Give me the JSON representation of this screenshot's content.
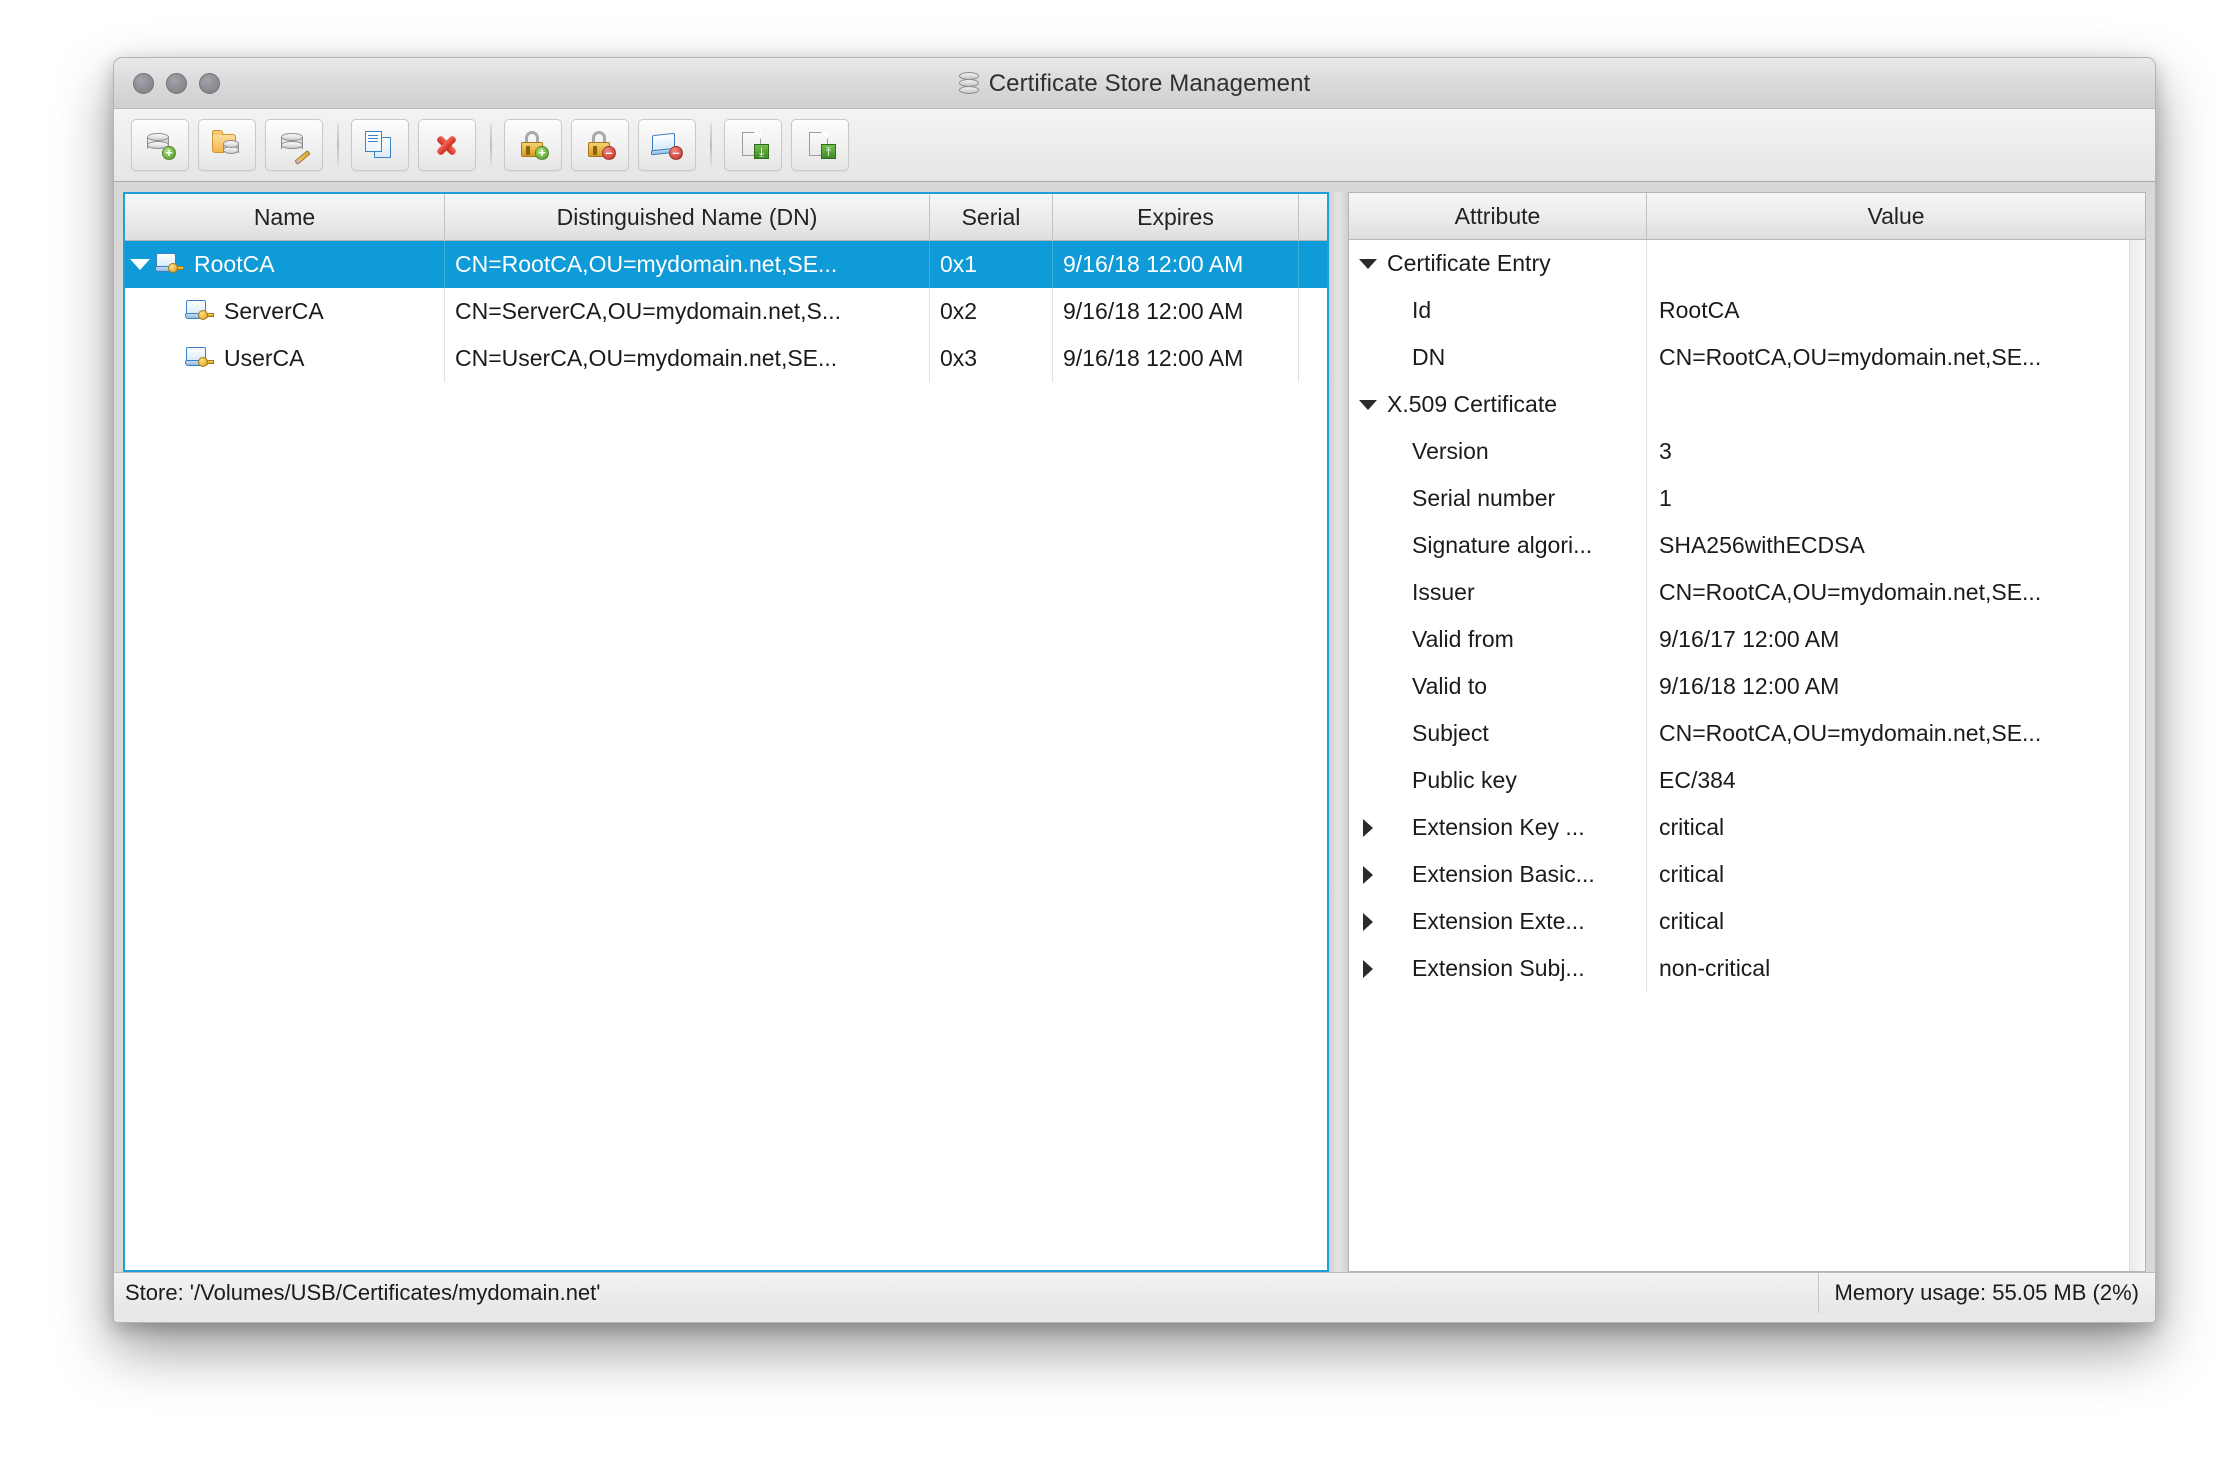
{
  "window": {
    "title": "Certificate Store Management",
    "title_icon": "database-icon",
    "traffic_lights": [
      "close",
      "minimize",
      "zoom"
    ]
  },
  "toolbar": {
    "groups": [
      {
        "buttons": [
          {
            "name": "new-store-button",
            "icon": "database-add-icon",
            "tooltip": "New store"
          },
          {
            "name": "open-store-button",
            "icon": "folder-database-icon",
            "tooltip": "Open store"
          },
          {
            "name": "edit-store-button",
            "icon": "database-edit-icon",
            "tooltip": "Edit store"
          }
        ]
      },
      {
        "buttons": [
          {
            "name": "copy-button",
            "icon": "copy-documents-icon",
            "tooltip": "Copy"
          },
          {
            "name": "delete-button",
            "icon": "red-x-icon",
            "tooltip": "Delete"
          }
        ]
      },
      {
        "buttons": [
          {
            "name": "add-key-button",
            "icon": "padlock-add-icon",
            "tooltip": "Add key"
          },
          {
            "name": "remove-key-button",
            "icon": "padlock-remove-icon",
            "tooltip": "Remove key"
          },
          {
            "name": "remove-cert-button",
            "icon": "cert-remove-icon",
            "tooltip": "Remove certificate"
          }
        ]
      },
      {
        "buttons": [
          {
            "name": "export-button",
            "icon": "document-export-icon",
            "tooltip": "Export"
          },
          {
            "name": "import-button",
            "icon": "document-import-icon",
            "tooltip": "Import"
          }
        ]
      }
    ]
  },
  "cert_table": {
    "columns": [
      "Name",
      "Distinguished Name (DN)",
      "Serial",
      "Expires"
    ],
    "rows": [
      {
        "name": "RootCA",
        "dn": "CN=RootCA,OU=mydomain.net,SE...",
        "serial": "0x1",
        "expires": "9/16/18 12:00 AM",
        "level": 0,
        "expanded": true,
        "selected": true,
        "icon": "certificate-key-icon"
      },
      {
        "name": "ServerCA",
        "dn": "CN=ServerCA,OU=mydomain.net,S...",
        "serial": "0x2",
        "expires": "9/16/18 12:00 AM",
        "level": 1,
        "expanded": false,
        "selected": false,
        "icon": "certificate-key-icon"
      },
      {
        "name": "UserCA",
        "dn": "CN=UserCA,OU=mydomain.net,SE...",
        "serial": "0x3",
        "expires": "9/16/18 12:00 AM",
        "level": 1,
        "expanded": false,
        "selected": false,
        "icon": "certificate-key-icon"
      }
    ]
  },
  "detail_table": {
    "columns": [
      "Attribute",
      "Value"
    ],
    "rows": [
      {
        "attribute": "Certificate Entry",
        "value": "",
        "level": 0,
        "twisty": "down"
      },
      {
        "attribute": "Id",
        "value": "RootCA",
        "level": 1,
        "twisty": "none"
      },
      {
        "attribute": "DN",
        "value": "CN=RootCA,OU=mydomain.net,SE...",
        "level": 1,
        "twisty": "none"
      },
      {
        "attribute": "X.509 Certificate",
        "value": "",
        "level": 0,
        "twisty": "down"
      },
      {
        "attribute": "Version",
        "value": "3",
        "level": 1,
        "twisty": "none"
      },
      {
        "attribute": "Serial number",
        "value": "1",
        "level": 1,
        "twisty": "none"
      },
      {
        "attribute": "Signature algori...",
        "value": "SHA256withECDSA",
        "level": 1,
        "twisty": "none"
      },
      {
        "attribute": "Issuer",
        "value": "CN=RootCA,OU=mydomain.net,SE...",
        "level": 1,
        "twisty": "none"
      },
      {
        "attribute": "Valid from",
        "value": "9/16/17 12:00 AM",
        "level": 1,
        "twisty": "none"
      },
      {
        "attribute": "Valid to",
        "value": "9/16/18 12:00 AM",
        "level": 1,
        "twisty": "none"
      },
      {
        "attribute": "Subject",
        "value": "CN=RootCA,OU=mydomain.net,SE...",
        "level": 1,
        "twisty": "none"
      },
      {
        "attribute": "Public key",
        "value": "EC/384",
        "level": 1,
        "twisty": "none"
      },
      {
        "attribute": "Extension Key ...",
        "value": "critical",
        "level": 1,
        "twisty": "right"
      },
      {
        "attribute": "Extension Basic...",
        "value": "critical",
        "level": 1,
        "twisty": "right"
      },
      {
        "attribute": "Extension Exte...",
        "value": "critical",
        "level": 1,
        "twisty": "right"
      },
      {
        "attribute": "Extension Subj...",
        "value": "non-critical",
        "level": 1,
        "twisty": "right"
      }
    ]
  },
  "statusbar": {
    "store": "Store: '/Volumes/USB/Certificates/mydomain.net'",
    "memory": "Memory usage: 55.05 MB (2%)"
  },
  "colors": {
    "selection": "#0f9bd7",
    "focus_border": "#1fa0d8",
    "window_chrome": "#e0e0e0"
  }
}
